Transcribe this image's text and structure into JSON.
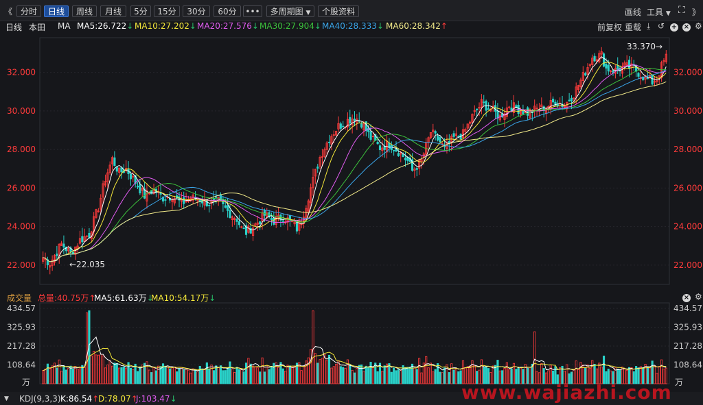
{
  "toolbar": {
    "back_glyph": "《",
    "periods": [
      "分时",
      "日线",
      "周线",
      "月线",
      "5分",
      "15分",
      "30分",
      "60分"
    ],
    "active_period": "日线",
    "more_glyph": "•••",
    "multi_period_label": "多周期图",
    "profile_label": "个股资料",
    "draw_label": "画线",
    "tools_label": "工具",
    "fullscreen_glyph": "⛶",
    "forward_glyph": "》"
  },
  "ma_header": {
    "period_label": "日线",
    "stock_name": "本田",
    "indicator": "MA",
    "ma5": "MA5:26.722",
    "ma10": "MA10:27.202",
    "ma20": "MA20:27.576",
    "ma30": "MA30:27.904",
    "ma40": "MA40:28.333",
    "ma60": "MA60:28.342",
    "adjust_label": "前复权",
    "overlay_label": "重载"
  },
  "price_axis": {
    "ticks": [
      "32.000",
      "30.000",
      "28.000",
      "26.000",
      "24.000",
      "22.000"
    ],
    "high_label": "33.370",
    "low_label": "22.035"
  },
  "volume_header": {
    "title": "成交量",
    "total": "总量:40.75万",
    "ma5": "MA5:61.63万",
    "ma10": "MA10:54.17万"
  },
  "volume_axis": {
    "ticks": [
      "434.57",
      "325.93",
      "217.28",
      "108.64"
    ],
    "unit": "万"
  },
  "kdj_header": {
    "title": "KDJ(9,3,3)",
    "k": "K:86.54",
    "d": "D:78.07",
    "j": "J:103.47"
  },
  "watermark": "www.wajiazhi.com",
  "colors": {
    "up": "#ff3b3b",
    "down": "#2ad1c9",
    "ma5": "#ffffff",
    "ma10": "#f5e83a",
    "ma20": "#e05cf0",
    "ma30": "#3cc23c",
    "ma40": "#3aa5e8",
    "ma60": "#f2ea8a",
    "active_tab": "#1d4d9a"
  },
  "chart_data": {
    "type": "candlestick",
    "price_range": [
      21.0,
      33.8
    ],
    "close_anchors": [
      [
        0,
        22.4
      ],
      [
        3,
        22.1
      ],
      [
        8,
        23.1
      ],
      [
        12,
        22.6
      ],
      [
        16,
        23.3
      ],
      [
        20,
        23.6
      ],
      [
        24,
        25.0
      ],
      [
        27,
        26.5
      ],
      [
        30,
        27.5
      ],
      [
        33,
        26.8
      ],
      [
        36,
        27.0
      ],
      [
        40,
        26.3
      ],
      [
        44,
        25.6
      ],
      [
        48,
        25.9
      ],
      [
        52,
        25.5
      ],
      [
        56,
        25.6
      ],
      [
        60,
        25.2
      ],
      [
        64,
        25.5
      ],
      [
        68,
        25.4
      ],
      [
        72,
        25.2
      ],
      [
        76,
        25.3
      ],
      [
        80,
        24.8
      ],
      [
        84,
        24.4
      ],
      [
        86,
        23.9
      ],
      [
        88,
        23.7
      ],
      [
        92,
        24.1
      ],
      [
        96,
        24.6
      ],
      [
        100,
        24.3
      ],
      [
        104,
        24.5
      ],
      [
        108,
        24.2
      ],
      [
        110,
        23.9
      ],
      [
        112,
        24.3
      ],
      [
        116,
        26.0
      ],
      [
        120,
        27.6
      ],
      [
        124,
        28.6
      ],
      [
        128,
        29.2
      ],
      [
        132,
        29.5
      ],
      [
        135,
        29.7
      ],
      [
        138,
        29.4
      ],
      [
        142,
        28.6
      ],
      [
        146,
        28.1
      ],
      [
        150,
        28.3
      ],
      [
        154,
        27.9
      ],
      [
        158,
        27.4
      ],
      [
        160,
        26.9
      ],
      [
        164,
        27.4
      ],
      [
        168,
        28.9
      ],
      [
        172,
        28.4
      ],
      [
        174,
        28.0
      ],
      [
        178,
        28.6
      ],
      [
        182,
        28.8
      ],
      [
        186,
        29.7
      ],
      [
        190,
        30.4
      ],
      [
        194,
        30.1
      ],
      [
        198,
        29.7
      ],
      [
        202,
        30.3
      ],
      [
        206,
        30.1
      ],
      [
        210,
        29.9
      ],
      [
        214,
        30.1
      ],
      [
        218,
        30.2
      ],
      [
        222,
        30.5
      ],
      [
        226,
        30.3
      ],
      [
        230,
        30.9
      ],
      [
        234,
        31.8
      ],
      [
        238,
        32.8
      ],
      [
        242,
        32.9
      ],
      [
        244,
        32.2
      ],
      [
        248,
        32.1
      ],
      [
        252,
        32.3
      ],
      [
        256,
        32.2
      ],
      [
        260,
        31.8
      ],
      [
        264,
        31.5
      ],
      [
        266,
        31.7
      ],
      [
        268,
        32.3
      ],
      [
        270,
        32.8
      ]
    ],
    "moving_averages": [
      "MA5",
      "MA10",
      "MA20",
      "MA30",
      "MA40",
      "MA60"
    ],
    "volume_range": [
      0,
      434.57
    ],
    "volume_unit": "万"
  }
}
